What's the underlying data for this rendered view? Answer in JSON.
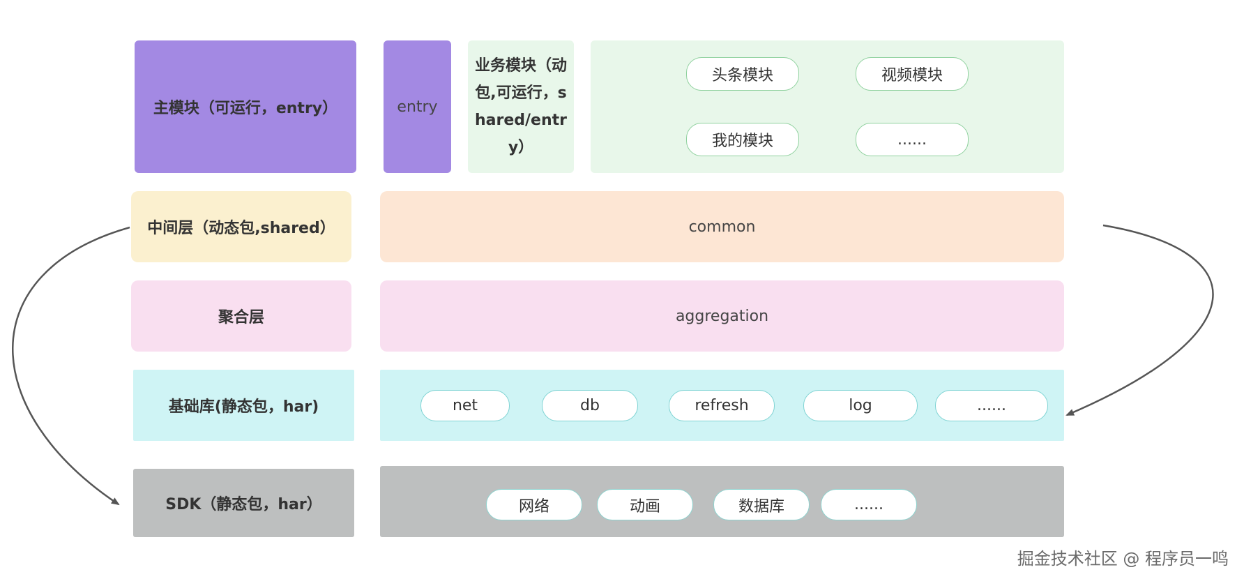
{
  "rows": {
    "main": {
      "label": "主模块（可运行，entry）",
      "entry": "entry",
      "business_label": "业务模块（动包,可运行，shared/entry）",
      "modules": [
        "头条模块",
        "视频模块",
        "我的模块",
        "......"
      ]
    },
    "middle": {
      "label": "中间层（动态包,shared）",
      "content": "common"
    },
    "aggregation": {
      "label": "聚合层",
      "content": "aggregation"
    },
    "base": {
      "label": "基础库(静态包，har)",
      "items": [
        "net",
        "db",
        "refresh",
        "log",
        "......"
      ]
    },
    "sdk": {
      "label": "SDK（静态包，har）",
      "items": [
        "网络",
        "动画",
        "数据库",
        "......"
      ]
    }
  },
  "watermark": "掘金技术社区 @ 程序员一鸣",
  "colors": {
    "main": "#a389e3",
    "business": "#e8f7ea",
    "middle_label": "#fbf0cf",
    "middle": "#fde6d4",
    "aggregation": "#f9dff0",
    "base": "#cff4f5",
    "sdk": "#bdbfbf",
    "arrow": "#555555"
  }
}
